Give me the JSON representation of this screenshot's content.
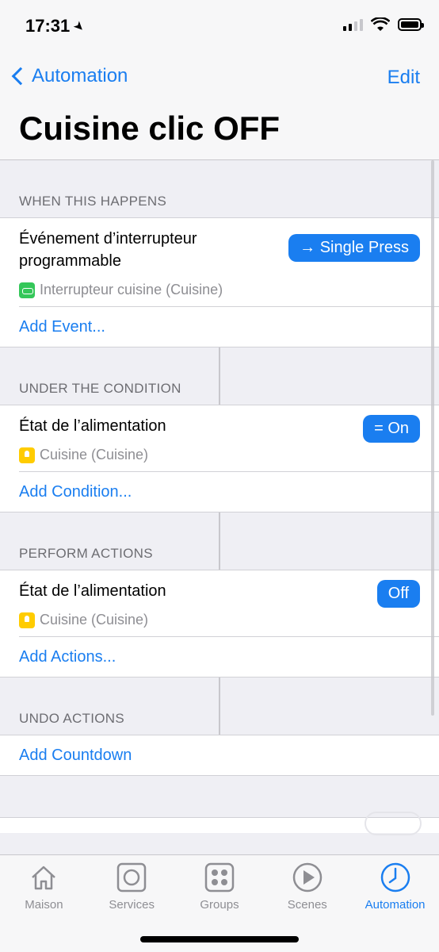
{
  "status": {
    "time": "17:31"
  },
  "nav": {
    "back_label": "Automation",
    "edit_label": "Edit",
    "title": "Cuisine clic OFF"
  },
  "sections": {
    "when": {
      "header": "WHEN THIS HAPPENS",
      "title": "Événement d’interrupteur programmable",
      "pill": "→ Single Press",
      "device": "Interrupteur cuisine (Cuisine)",
      "add": "Add Event..."
    },
    "condition": {
      "header": "UNDER THE CONDITION",
      "title": "État de l’alimentation",
      "pill": "= On",
      "device": "Cuisine (Cuisine)",
      "add": "Add Condition..."
    },
    "actions": {
      "header": "PERFORM ACTIONS",
      "title": "État de l’alimentation",
      "pill": "Off",
      "device": "Cuisine (Cuisine)",
      "add": "Add Actions..."
    },
    "undo": {
      "header": "UNDO ACTIONS",
      "add": "Add Countdown"
    }
  },
  "tabs": [
    {
      "label": "Maison",
      "icon": "house-icon",
      "active": false
    },
    {
      "label": "Services",
      "icon": "services-icon",
      "active": false
    },
    {
      "label": "Groups",
      "icon": "groups-icon",
      "active": false
    },
    {
      "label": "Scenes",
      "icon": "scenes-icon",
      "active": false
    },
    {
      "label": "Automation",
      "icon": "automation-clock-icon",
      "active": true
    }
  ],
  "colors": {
    "accent": "#1a7ef0",
    "background": "#efeff4"
  }
}
